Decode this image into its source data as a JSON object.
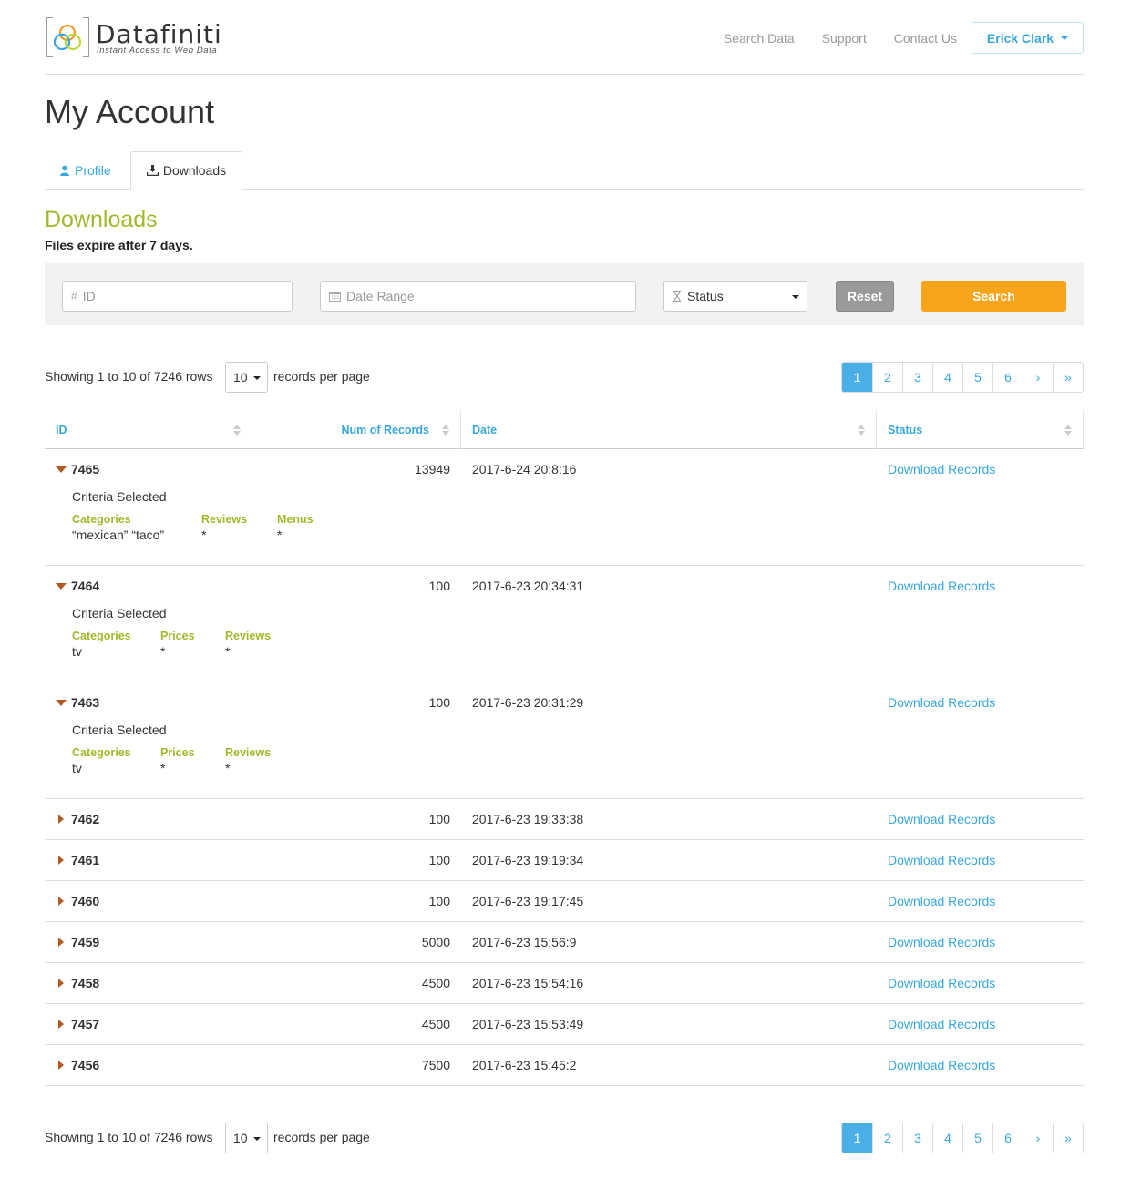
{
  "brand": {
    "name": "Datafiniti",
    "tagline": "Instant Access to Web Data"
  },
  "nav": {
    "items": [
      "Search Data",
      "Support",
      "Contact Us"
    ],
    "user": "Erick Clark"
  },
  "page_title": "My Account",
  "tabs": [
    {
      "label": "Profile",
      "icon": "user-icon",
      "active": false
    },
    {
      "label": "Downloads",
      "icon": "download-icon",
      "active": true
    }
  ],
  "section": {
    "title": "Downloads",
    "note": "Files expire after 7 days."
  },
  "filters": {
    "id_placeholder": "ID",
    "date_placeholder": "Date Range",
    "status_value": "Status",
    "reset_label": "Reset",
    "search_label": "Search"
  },
  "pagination": {
    "showing": "Showing 1 to 10 of 7246 rows",
    "per_page": "10",
    "per_page_label": "records per page",
    "pages": [
      "1",
      "2",
      "3",
      "4",
      "5",
      "6",
      "›",
      "»"
    ],
    "active_page": "1"
  },
  "table": {
    "headers": [
      "ID",
      "Num of Records",
      "Date",
      "Status"
    ],
    "criteria_label": "Criteria Selected",
    "rows": [
      {
        "id": "7465",
        "num": "13949",
        "date": "2017-6-24 20:8:16",
        "status": "Download Records",
        "expanded": true,
        "criteria": [
          {
            "k": "Categories",
            "v": "“mexican” “taco”"
          },
          {
            "k": "Reviews",
            "v": "*"
          },
          {
            "k": "Menus",
            "v": "*"
          }
        ]
      },
      {
        "id": "7464",
        "num": "100",
        "date": "2017-6-23 20:34:31",
        "status": "Download Records",
        "expanded": true,
        "criteria": [
          {
            "k": "Categories",
            "v": "tv"
          },
          {
            "k": "Prices",
            "v": "*"
          },
          {
            "k": "Reviews",
            "v": "*"
          }
        ]
      },
      {
        "id": "7463",
        "num": "100",
        "date": "2017-6-23 20:31:29",
        "status": "Download Records",
        "expanded": true,
        "criteria": [
          {
            "k": "Categories",
            "v": "tv"
          },
          {
            "k": "Prices",
            "v": "*"
          },
          {
            "k": "Reviews",
            "v": "*"
          }
        ]
      },
      {
        "id": "7462",
        "num": "100",
        "date": "2017-6-23 19:33:38",
        "status": "Download Records",
        "expanded": false
      },
      {
        "id": "7461",
        "num": "100",
        "date": "2017-6-23 19:19:34",
        "status": "Download Records",
        "expanded": false
      },
      {
        "id": "7460",
        "num": "100",
        "date": "2017-6-23 19:17:45",
        "status": "Download Records",
        "expanded": false
      },
      {
        "id": "7459",
        "num": "5000",
        "date": "2017-6-23 15:56:9",
        "status": "Download Records",
        "expanded": false
      },
      {
        "id": "7458",
        "num": "4500",
        "date": "2017-6-23 15:54:16",
        "status": "Download Records",
        "expanded": false
      },
      {
        "id": "7457",
        "num": "4500",
        "date": "2017-6-23 15:53:49",
        "status": "Download Records",
        "expanded": false
      },
      {
        "id": "7456",
        "num": "7500",
        "date": "2017-6-23 15:45:2",
        "status": "Download Records",
        "expanded": false
      }
    ]
  },
  "colors": {
    "accent_blue": "#38a7dd",
    "olive": "#a4b82c",
    "search_orange": "#f9a51c",
    "reset_gray": "#9a9a9a",
    "expand_arrow": "#b35a22"
  }
}
